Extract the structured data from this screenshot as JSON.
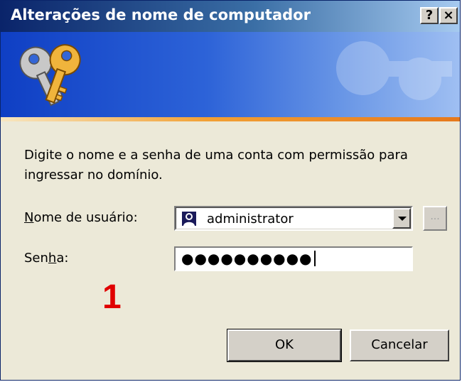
{
  "window": {
    "title": "Alterações de nome de computador",
    "help_label": "?",
    "close_label": "×"
  },
  "instructions": "Digite o nome e a senha de uma conta com permissão para ingressar no domínio.",
  "username": {
    "label_before": "N",
    "label_accel": "",
    "label_after": "ome de usuário:",
    "value": "administrator",
    "browse_label": "..."
  },
  "password": {
    "label_before": "Sen",
    "label_accel": "h",
    "label_after": "a:",
    "masked_value": "●●●●●●●●●●"
  },
  "annotation": "1",
  "buttons": {
    "ok": "OK",
    "cancel": "Cancelar"
  },
  "colors": {
    "titlebar_start": "#0a246a",
    "banner_blue": "#2d63d8",
    "stripe_orange": "#f2a034",
    "annotation_red": "#e00000",
    "dialog_face": "#ece9d8"
  },
  "icons": [
    "keys-icon",
    "user-icon",
    "dropdown-arrow-icon"
  ]
}
